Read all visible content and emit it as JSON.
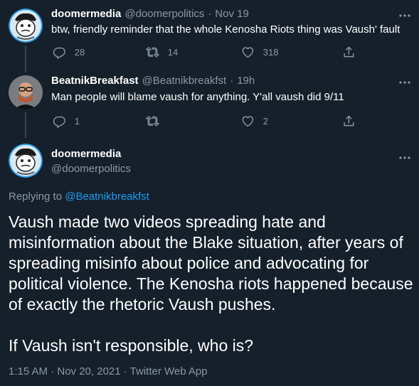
{
  "tweets": [
    {
      "author_name": "doomermedia",
      "handle": "@doomerpolitics",
      "separator": "·",
      "time": "Nov 19",
      "text": "btw, friendly reminder that the whole Kenosha Riots thing was Vaush' fault",
      "replies": "28",
      "retweets": "14",
      "likes": "318"
    },
    {
      "author_name": "BeatnikBreakfast",
      "handle": "@Beatnikbreakfst",
      "separator": "·",
      "time": "19h",
      "text": "Man people will blame vaush for anything. Y'all vaush did 9/11",
      "replies": "1",
      "retweets": "",
      "likes": "2"
    }
  ],
  "main_tweet": {
    "author_name": "doomermedia",
    "handle": "@doomerpolitics",
    "replying_to_label": "Replying to",
    "replying_to_handle": "@Beatnikbreakfst",
    "paragraph_1": "Vaush made two videos spreading hate and misinformation about the Blake situation, after years of spreading misinfo about police and advocating for political violence. The Kenosha riots happened because of exactly the rhetoric Vaush pushes.",
    "paragraph_2": "If Vaush isn't responsible, who is?",
    "timestamp": "1:15 AM · Nov 20, 2021 · Twitter Web App"
  },
  "icons": {
    "more": "more-horizontal-icon",
    "reply": "reply-icon",
    "retweet": "retweet-icon",
    "like": "heart-icon",
    "share": "share-icon"
  },
  "colors": {
    "background": "#15202b",
    "text": "#ffffff",
    "secondary": "#8b98a5",
    "link": "#1d9bf0",
    "divider": "#38444d"
  }
}
